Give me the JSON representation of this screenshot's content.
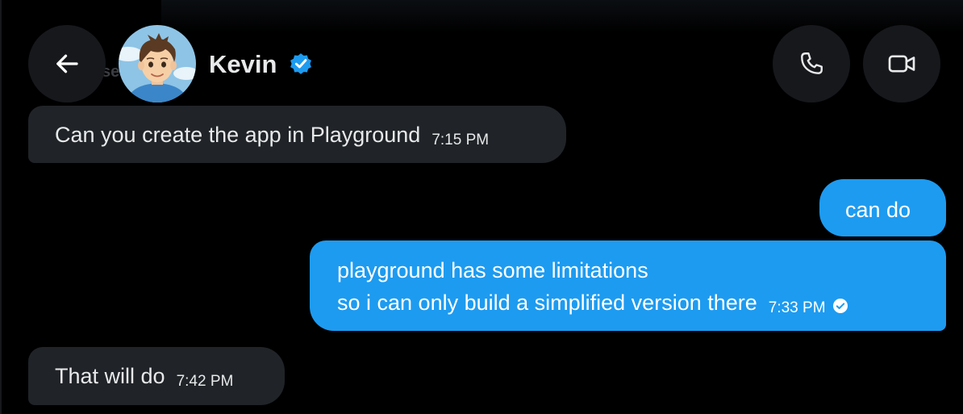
{
  "header": {
    "contact_name": "Kevin",
    "ghost_text": "se",
    "icons": {
      "back": "arrow-left-icon",
      "verified": "verified-badge-icon",
      "call": "phone-icon",
      "video": "video-camera-icon"
    }
  },
  "messages": [
    {
      "direction": "received",
      "text": "Can you create the app in Playground",
      "time": "7:15 PM"
    },
    {
      "direction": "sent",
      "text": "can do"
    },
    {
      "direction": "sent",
      "lines": [
        "playground has some limitations",
        "so i can only build a simplified version there"
      ],
      "time": "7:33 PM",
      "status_icon": "read-check-icon"
    },
    {
      "direction": "received",
      "text": "That will do",
      "time": "7:42 PM"
    }
  ],
  "colors": {
    "background": "#000000",
    "received_bubble": "#202327",
    "sent_bubble": "#1d9bf0",
    "verified": "#1d9bf0",
    "button_bg": "#16181c"
  }
}
